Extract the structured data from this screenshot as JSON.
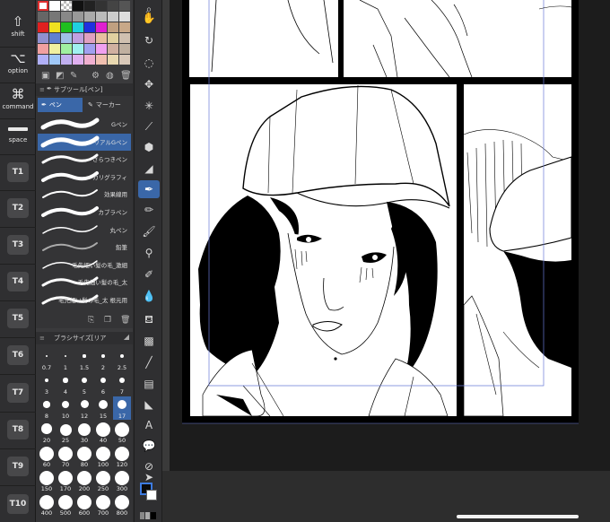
{
  "modifiers": [
    {
      "glyph": "⇧",
      "label": "shift"
    },
    {
      "glyph": "⌥",
      "label": "option"
    },
    {
      "glyph": "⌘",
      "label": "command"
    },
    {
      "glyph": "",
      "label": "space"
    }
  ],
  "tkeys": [
    "T1",
    "T2",
    "T3",
    "T4",
    "T5",
    "T6",
    "T7",
    "T8",
    "T9",
    "T10"
  ],
  "subtool": {
    "title": "サブツール[ペン]",
    "tab_pen": "ペン",
    "tab_marker": "マーカー",
    "brushes": [
      "Gペン",
      "リアルGペン",
      "さらつきペン",
      "カリグラフィ",
      "効果線用",
      "カブラペン",
      "丸ペン",
      "鉛筆",
      "毛先細い髪の毛_激細",
      "毛先細い髪の毛_太",
      "毛先細い髪の毛_太 根元用"
    ],
    "selected_brush": "リアルGペン"
  },
  "brush_size": {
    "title": "ブラシサイズ[リア",
    "sizes": [
      "0.7",
      "1",
      "1.5",
      "2",
      "2.5",
      "3",
      "4",
      "5",
      "6",
      "7",
      "8",
      "10",
      "12",
      "15",
      "17",
      "20",
      "25",
      "30",
      "40",
      "50",
      "60",
      "70",
      "80",
      "100",
      "120",
      "150",
      "170",
      "200",
      "250",
      "300",
      "400",
      "500",
      "600",
      "700",
      "800"
    ],
    "selected_size": "17"
  },
  "colors": {
    "accent": "#3a67a8",
    "main_color": "#0a0a0a",
    "sub_color": "#ffffff"
  },
  "tools_icons": [
    "zoom-icon",
    "hand-icon",
    "rotate-icon",
    "lasso-icon",
    "move-icon",
    "wand-icon",
    "eyedropper-icon",
    "eraser-icon",
    "pen-icon",
    "pencil-icon",
    "brush-icon",
    "airbrush-icon",
    "decoration-icon",
    "blend-icon",
    "fill-icon",
    "gradient-icon",
    "figure-icon",
    "frame-icon",
    "ruler-icon",
    "text-icon",
    "balloon-icon",
    "effect-line-icon",
    "object-icon"
  ]
}
